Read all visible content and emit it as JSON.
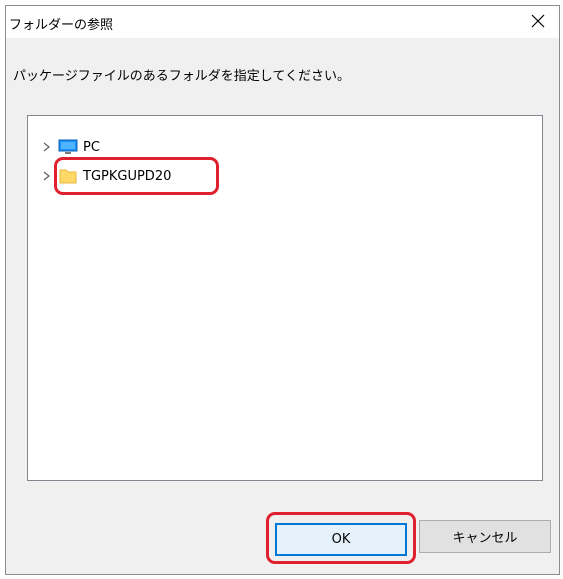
{
  "dialog": {
    "title": "フォルダーの参照",
    "instruction": "パッケージファイルのあるフォルダを指定してください。"
  },
  "tree": {
    "items": [
      {
        "label": "PC",
        "icon": "computer-icon"
      },
      {
        "label": "TGPKGUPD20",
        "icon": "folder-icon"
      }
    ]
  },
  "buttons": {
    "ok_label": "OK",
    "cancel_label": "キャンセル"
  },
  "colors": {
    "annotation": "#e0202e",
    "accent": "#0078d7",
    "folder": "#ffd866"
  }
}
